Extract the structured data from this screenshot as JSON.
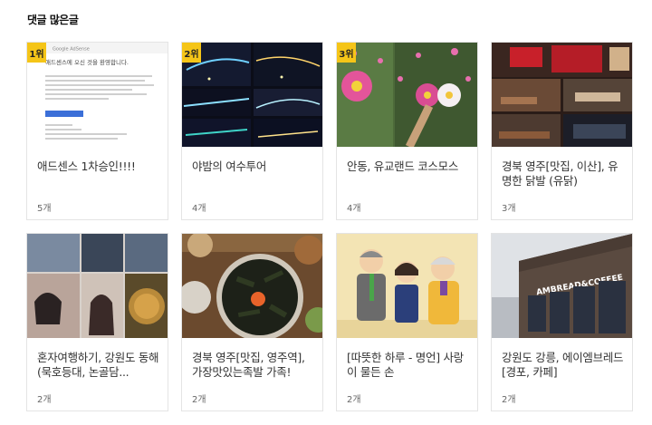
{
  "section": {
    "title": "댓글 많은글"
  },
  "cards": [
    {
      "rank": "1위",
      "title": "애드센스 1차승인!!!!",
      "count": "5개",
      "thumb": "adsense-email-screenshot",
      "thumb_text": {
        "brand": "Google AdSense",
        "headline": "애드센스에 오신 것을 환영합니다."
      }
    },
    {
      "rank": "2위",
      "title": "야밤의 여수투어",
      "count": "4개",
      "thumb": "night-bridge-photos"
    },
    {
      "rank": "3위",
      "title": "안동, 유교랜드 코스모스",
      "count": "4개",
      "thumb": "cosmos-flowers"
    },
    {
      "rank": "",
      "title": "경북 영주[맛집, 이산], 유명한 닭발 (유닭)",
      "count": "3개",
      "thumb": "restaurant-interior"
    },
    {
      "rank": "",
      "title": "혼자여행하기, 강원도 동해(묵호등대, 논골담...",
      "count": "2개",
      "thumb": "travel-collage"
    },
    {
      "rank": "",
      "title": "경북 영주[맛집, 영주역], 가장맛있는족발 가족!",
      "count": "2개",
      "thumb": "bibimbap-food"
    },
    {
      "rank": "",
      "title": "[따뜻한 하루 - 명언] 사랑이 물든 손",
      "count": "2개",
      "thumb": "family-illustration"
    },
    {
      "rank": "",
      "title": "강원도 강릉, 에이엠브레드 [경포, 카페]",
      "count": "2개",
      "thumb": "cafe-building",
      "thumb_text": {
        "sign": "AMBREAD&COFFEE"
      }
    }
  ],
  "colors": {
    "rank_badge": "#f5c518",
    "border": "#e4e4e4",
    "title": "#333333",
    "count": "#666666"
  }
}
